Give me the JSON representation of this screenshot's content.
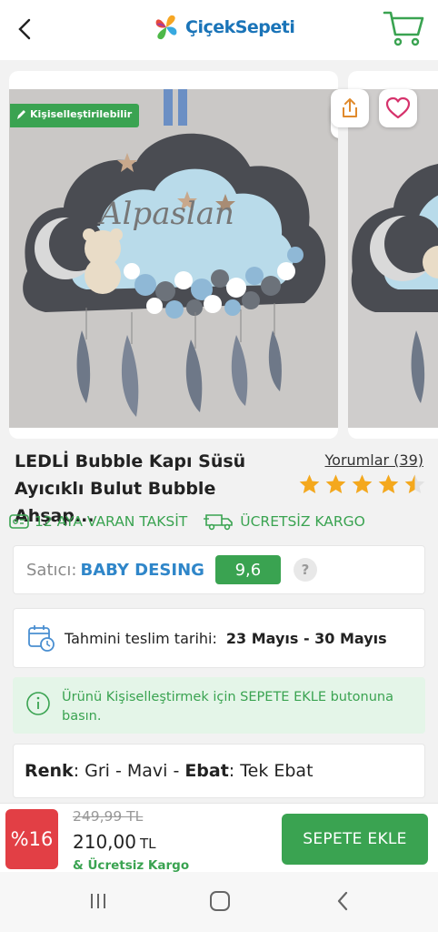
{
  "header": {
    "brand_name": "ÇiçekSepeti",
    "back_icon": "chevron-left-icon",
    "cart_icon": "cart-icon"
  },
  "gallery": {
    "badge_label": "Kişiselleştirilebilir",
    "share_icon": "share-icon",
    "favorite_icon": "heart-icon",
    "image_text": "Alpaslan"
  },
  "product": {
    "title_line1": "LEDLİ Bubble Kapı Süsü",
    "title_line2": "Ayıcıklı Bulut Bubble Ahşap...",
    "reviews_label": "Yorumlar (39)",
    "rating": 4.5,
    "rating_max": 5
  },
  "features": {
    "installment": "12 AYA VARAN TAKSİT",
    "free_shipping": "ÜCRETSİZ KARGO"
  },
  "seller": {
    "label": "Satıcı:",
    "name": "BABY DESING",
    "score": "9,6",
    "help": "?"
  },
  "delivery": {
    "label": "Tahmini teslim tarihi:",
    "value": "23 Mayıs - 30 Mayıs"
  },
  "notice": {
    "text_line1": "Ürünü Kişiselleştirmek için SEPETE EKLE butonuna",
    "text_line2": "basın."
  },
  "variant": {
    "color_label": "Renk",
    "color_value": "Gri - Mavi",
    "sep": "-",
    "size_label": "Ebat",
    "size_value": "Tek Ebat"
  },
  "purchase": {
    "discount": "%16",
    "old_price": "249,99 TL",
    "new_price": "210,00",
    "currency": "TL",
    "free_cargo": "& Ücretsiz Kargo",
    "add_to_cart": "SEPETE EKLE"
  },
  "colors": {
    "accent_green": "#3aa351",
    "seller_blue": "#2f86c9",
    "discount_red": "#e23f45"
  }
}
